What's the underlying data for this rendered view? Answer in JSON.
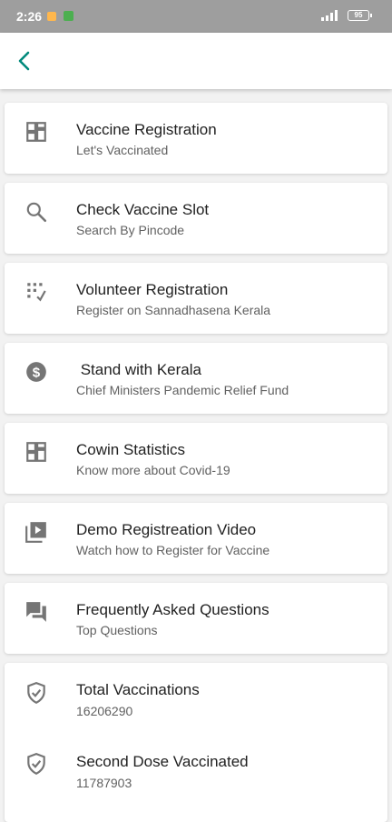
{
  "status_bar": {
    "time": "2:26",
    "battery": "95"
  },
  "menu": [
    {
      "title": "Vaccine Registration",
      "subtitle": "Let's Vaccinated",
      "icon": "dashboard-icon"
    },
    {
      "title": "Check Vaccine Slot",
      "subtitle": "Search By Pincode",
      "icon": "search-icon"
    },
    {
      "title": "Volunteer Registration",
      "subtitle": "Register on Sannadhasena Kerala",
      "icon": "dialpad-icon"
    },
    {
      "title": " Stand with Kerala",
      "subtitle": "Chief Ministers Pandemic Relief Fund",
      "icon": "dollar-coin-icon"
    },
    {
      "title": "Cowin Statistics",
      "subtitle": "Know more about Covid-19",
      "icon": "dashboard-icon"
    },
    {
      "title": "Demo Registreation Video",
      "subtitle": "Watch how to Register for Vaccine",
      "icon": "video-library-icon"
    },
    {
      "title": "Frequently Asked Questions",
      "subtitle": "Top Questions",
      "icon": "forum-icon"
    }
  ],
  "stats": [
    {
      "title": "Total Vaccinations",
      "value": "16206290",
      "icon": "shield-check-icon"
    },
    {
      "title": "Second Dose Vaccinated",
      "value": "11787903",
      "icon": "shield-check-icon"
    }
  ],
  "colors": {
    "accent": "#00897b",
    "icon_gray": "#757575",
    "status_bar": "#9e9e9e"
  }
}
